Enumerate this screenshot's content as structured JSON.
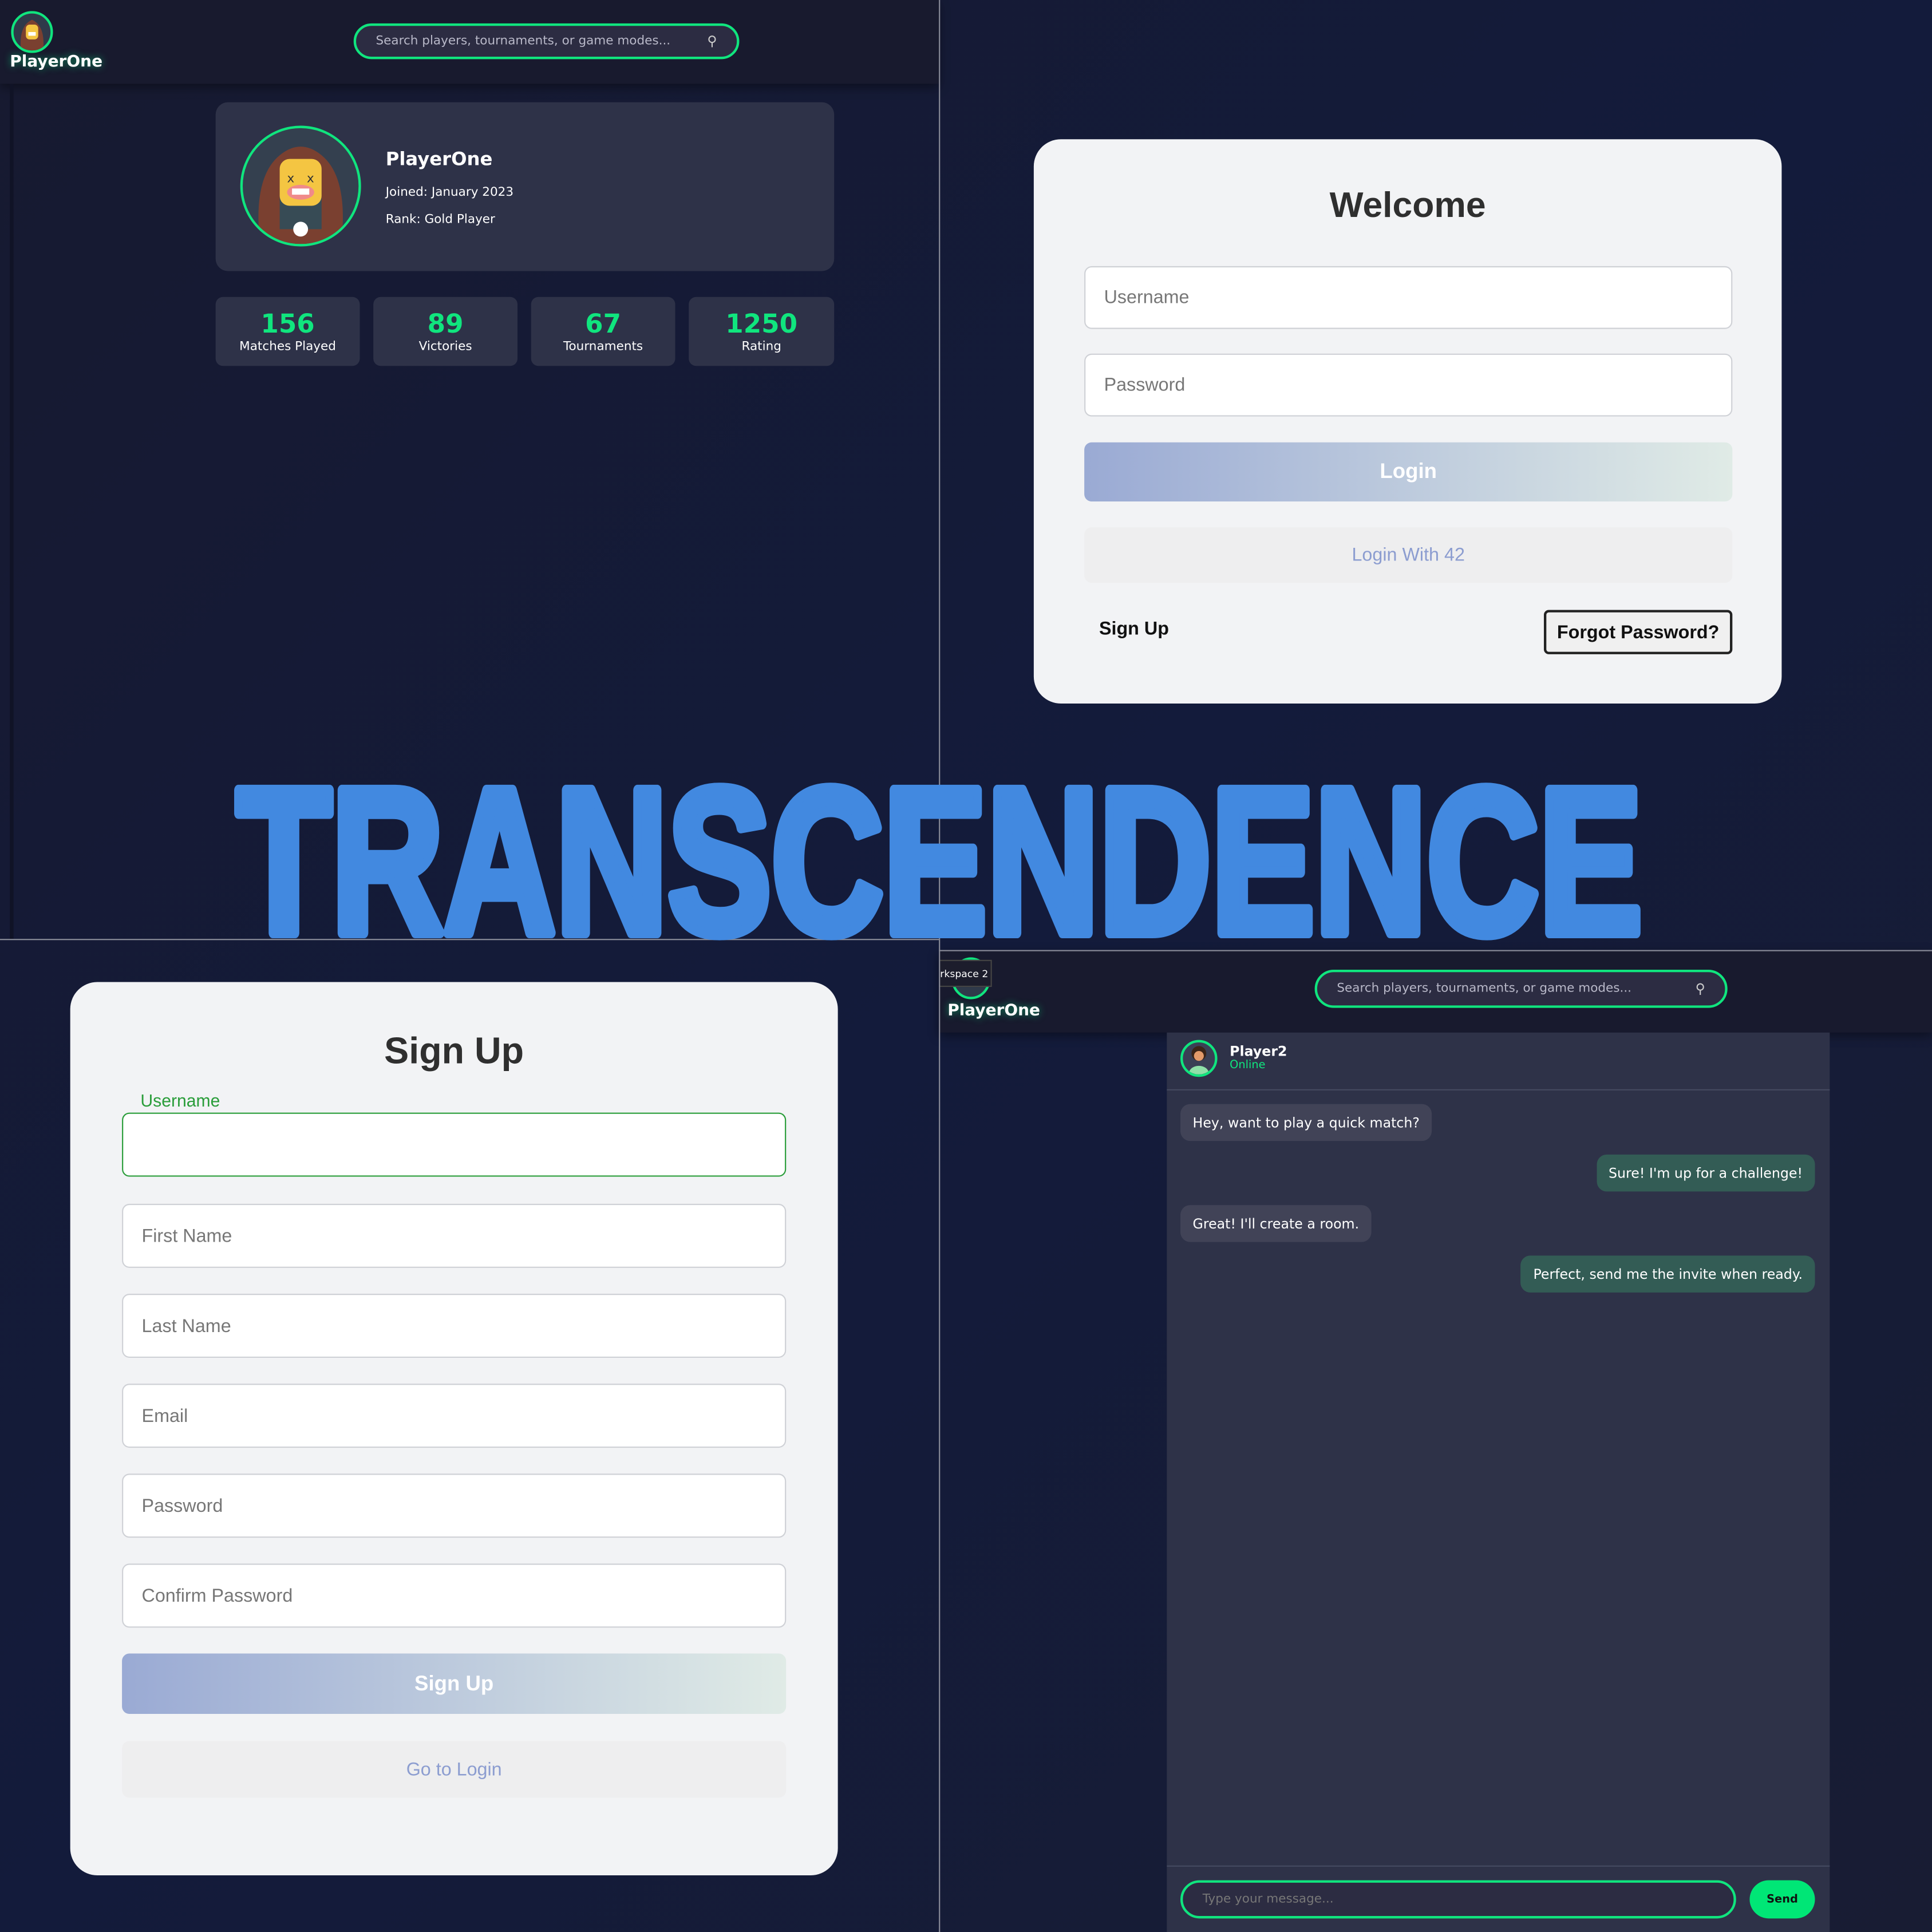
{
  "profile_screen": {
    "logo_name": "PlayerOne",
    "search_placeholder": "Search players, tournaments, or game modes...",
    "search_icon": "magnifier-icon",
    "name": "PlayerOne",
    "joined": "Joined: January 2023",
    "rank": "Rank: Gold Player",
    "stats": [
      {
        "value": "156",
        "label": "Matches Played"
      },
      {
        "value": "89",
        "label": "Victories"
      },
      {
        "value": "67",
        "label": "Tournaments"
      },
      {
        "value": "1250",
        "label": "Rating"
      }
    ]
  },
  "login_screen": {
    "title": "Welcome",
    "username_placeholder": "Username",
    "password_placeholder": "Password",
    "login_label": "Login",
    "login42_label": "Login With 42",
    "signup_label": "Sign Up",
    "forgot_label": "Forgot Password?"
  },
  "banner": "TRANSCENDENCE",
  "signup_screen": {
    "title": "Sign Up",
    "username_label": "Username",
    "fields": [
      "First Name",
      "Last Name",
      "Email",
      "Password",
      "Confirm Password"
    ],
    "submit_label": "Sign Up",
    "goto_login_label": "Go to Login"
  },
  "chat_screen": {
    "tooltip": "rkspace 2",
    "logo_name": "PlayerOne",
    "search_placeholder": "Search players, tournaments, or game modes...",
    "contact_name": "Player2",
    "contact_status": "Online",
    "messages": [
      {
        "text": "Hey, want to play a quick match?",
        "side": "received"
      },
      {
        "text": "Sure! I'm up for a challenge!",
        "side": "sent"
      },
      {
        "text": "Great! I'll create a room.",
        "side": "received"
      },
      {
        "text": "Perfect, send me the invite when ready.",
        "side": "sent"
      }
    ],
    "input_placeholder": "Type your message...",
    "send_label": "Send"
  },
  "colors": {
    "accent": "#10e57e",
    "banner": "#4289e0",
    "card": "#2e3248",
    "header": "#181a2e"
  }
}
